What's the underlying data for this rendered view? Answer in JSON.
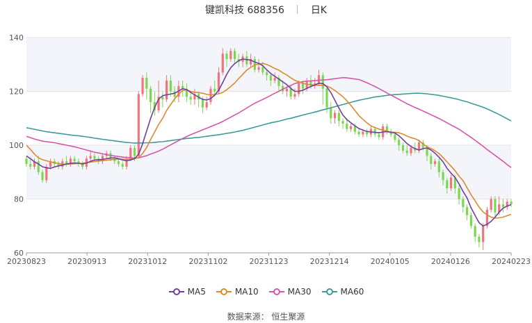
{
  "header": {
    "name": "键凯科技",
    "code": "688356",
    "period": "日K"
  },
  "source": "数据来源： 恒生聚源",
  "colors": {
    "up": "#f2737c",
    "down": "#79d84e",
    "ma5": "#6f3fa0",
    "ma10": "#e0882d",
    "ma30": "#d556a8",
    "ma60": "#3c9a9a",
    "band": "#f4f5fb",
    "grid": "#e3e3e3",
    "axis": "#555555"
  },
  "chart_data": {
    "type": "candlestick",
    "title": "键凯科技 688356 日K",
    "yticks": [
      60,
      80,
      100,
      120,
      140
    ],
    "ylim": [
      60,
      140
    ],
    "xticks": [
      "20230823",
      "20230913",
      "20231012",
      "20231102",
      "20231123",
      "20231214",
      "20240105",
      "20240126",
      "20240223"
    ],
    "legend": [
      {
        "key": "ma5",
        "label": "MA5"
      },
      {
        "key": "ma10",
        "label": "MA10"
      },
      {
        "key": "ma30",
        "label": "MA30"
      },
      {
        "key": "ma60",
        "label": "MA60"
      }
    ],
    "candles": [
      [
        95.0,
        93.0,
        96.0,
        92.0
      ],
      [
        93.0,
        92.0,
        95.0,
        91.0
      ],
      [
        92.0,
        94.0,
        95.0,
        91.0
      ],
      [
        94.0,
        90.0,
        96.0,
        89.0
      ],
      [
        90.0,
        87.0,
        91.0,
        86.0
      ],
      [
        87.0,
        92.0,
        93.0,
        86.0
      ],
      [
        92.0,
        94.0,
        95.0,
        91.0
      ],
      [
        94.0,
        93.0,
        95.0,
        92.0
      ],
      [
        93.0,
        92.0,
        94.0,
        91.0
      ],
      [
        92.0,
        94.0,
        95.0,
        91.0
      ],
      [
        94.0,
        93.0,
        96.0,
        92.0
      ],
      [
        93.0,
        95.0,
        96.0,
        92.0
      ],
      [
        95.0,
        94.0,
        96.0,
        93.0
      ],
      [
        94.0,
        93.0,
        95.0,
        92.0
      ],
      [
        93.0,
        92.0,
        94.0,
        91.0
      ],
      [
        92.0,
        95.0,
        96.0,
        91.0
      ],
      [
        95.0,
        96.0,
        98.0,
        94.0
      ],
      [
        96.0,
        95.0,
        97.0,
        94.0
      ],
      [
        95.0,
        94.0,
        96.0,
        93.0
      ],
      [
        94.0,
        96.0,
        97.0,
        93.0
      ],
      [
        96.0,
        97.0,
        98.0,
        95.0
      ],
      [
        97.0,
        95.0,
        98.0,
        94.0
      ],
      [
        95.0,
        94.0,
        96.0,
        93.0
      ],
      [
        94.0,
        93.0,
        95.0,
        92.0
      ],
      [
        93.0,
        92.0,
        94.0,
        91.0
      ],
      [
        92.0,
        95.0,
        96.0,
        91.0
      ],
      [
        95.0,
        99.0,
        100.0,
        94.0
      ],
      [
        99.0,
        96.0,
        100.0,
        94.0
      ],
      [
        96.0,
        119.0,
        120.0,
        95.0
      ],
      [
        119.0,
        125.0,
        126.0,
        118.0
      ],
      [
        125.0,
        121.0,
        127.0,
        117.0
      ],
      [
        121.0,
        116.0,
        122.0,
        112.0
      ],
      [
        116.0,
        113.0,
        120.0,
        111.0
      ],
      [
        113.0,
        118.0,
        124.0,
        112.0
      ],
      [
        118.0,
        117.0,
        120.0,
        114.0
      ],
      [
        117.0,
        124.0,
        126.0,
        116.0
      ],
      [
        124.0,
        120.0,
        126.0,
        118.0
      ],
      [
        120.0,
        118.0,
        122.0,
        116.0
      ],
      [
        118.0,
        122.0,
        124.0,
        116.0
      ],
      [
        122.0,
        121.0,
        124.0,
        118.0
      ],
      [
        121.0,
        118.0,
        123.0,
        116.0
      ],
      [
        118.0,
        117.0,
        120.0,
        115.0
      ],
      [
        117.0,
        119.0,
        121.0,
        115.0
      ],
      [
        119.0,
        117.0,
        120.0,
        114.0
      ],
      [
        117.0,
        114.0,
        118.0,
        112.0
      ],
      [
        114.0,
        116.0,
        118.0,
        113.0
      ],
      [
        116.0,
        121.0,
        122.0,
        115.0
      ],
      [
        121.0,
        120.0,
        124.0,
        118.0
      ],
      [
        120.0,
        127.0,
        129.0,
        119.0
      ],
      [
        127.0,
        134.0,
        136.0,
        126.0
      ],
      [
        134.0,
        132.0,
        135.0,
        129.0
      ],
      [
        132.0,
        135.0,
        136.0,
        131.0
      ],
      [
        135.0,
        132.0,
        136.0,
        130.0
      ],
      [
        132.0,
        131.0,
        134.0,
        129.0
      ],
      [
        131.0,
        133.0,
        134.0,
        129.0
      ],
      [
        133.0,
        130.0,
        135.0,
        129.0
      ],
      [
        130.0,
        132.0,
        134.0,
        129.0
      ],
      [
        132.0,
        128.0,
        133.0,
        127.0
      ],
      [
        128.0,
        129.0,
        132.0,
        127.0
      ],
      [
        129.0,
        127.0,
        131.0,
        126.0
      ],
      [
        127.0,
        126.0,
        128.0,
        124.0
      ],
      [
        126.0,
        124.0,
        127.0,
        122.0
      ],
      [
        124.0,
        125.0,
        127.0,
        123.0
      ],
      [
        125.0,
        122.0,
        126.0,
        120.0
      ],
      [
        122.0,
        120.0,
        124.0,
        119.0
      ],
      [
        120.0,
        121.0,
        122.0,
        118.0
      ],
      [
        121.0,
        118.0,
        122.0,
        117.0
      ],
      [
        118.0,
        119.0,
        121.0,
        117.0
      ],
      [
        119.0,
        123.0,
        124.0,
        118.0
      ],
      [
        123.0,
        121.0,
        124.0,
        119.0
      ],
      [
        121.0,
        124.0,
        125.0,
        120.0
      ],
      [
        124.0,
        122.0,
        126.0,
        121.0
      ],
      [
        122.0,
        123.0,
        125.0,
        121.0
      ],
      [
        123.0,
        126.0,
        128.0,
        122.0
      ],
      [
        126.0,
        121.0,
        127.0,
        115.0
      ],
      [
        121.0,
        114.0,
        122.0,
        112.0
      ],
      [
        114.0,
        110.0,
        116.0,
        108.0
      ],
      [
        110.0,
        112.0,
        113.0,
        108.0
      ],
      [
        112.0,
        109.0,
        113.0,
        107.0
      ],
      [
        109.0,
        108.0,
        110.0,
        106.0
      ],
      [
        108.0,
        106.0,
        110.0,
        105.0
      ],
      [
        106.0,
        107.0,
        108.0,
        105.0
      ],
      [
        107.0,
        105.0,
        108.0,
        104.0
      ],
      [
        105.0,
        104.0,
        106.0,
        103.0
      ],
      [
        104.0,
        105.0,
        106.0,
        103.0
      ],
      [
        105.0,
        104.0,
        106.0,
        103.0
      ],
      [
        104.0,
        106.0,
        107.0,
        103.0
      ],
      [
        106.0,
        104.0,
        107.0,
        103.0
      ],
      [
        104.0,
        103.0,
        105.0,
        102.0
      ],
      [
        103.0,
        107.0,
        108.0,
        102.0
      ],
      [
        107.0,
        105.0,
        108.0,
        104.0
      ],
      [
        105.0,
        104.0,
        106.0,
        103.0
      ],
      [
        104.0,
        102.0,
        105.0,
        101.0
      ],
      [
        102.0,
        100.0,
        103.0,
        98.0
      ],
      [
        100.0,
        98.0,
        101.0,
        97.0
      ],
      [
        98.0,
        97.0,
        100.0,
        96.0
      ],
      [
        97.0,
        99.0,
        100.0,
        96.0
      ],
      [
        99.0,
        98.0,
        101.0,
        97.0
      ],
      [
        98.0,
        101.0,
        102.0,
        97.0
      ],
      [
        101.0,
        99.0,
        102.0,
        98.0
      ],
      [
        99.0,
        96.0,
        100.0,
        94.0
      ],
      [
        96.0,
        93.0,
        97.0,
        91.0
      ],
      [
        93.0,
        94.0,
        95.0,
        92.0
      ],
      [
        94.0,
        90.0,
        95.0,
        88.0
      ],
      [
        90.0,
        87.0,
        91.0,
        85.0
      ],
      [
        87.0,
        84.0,
        88.0,
        82.0
      ],
      [
        84.0,
        88.0,
        89.0,
        83.0
      ],
      [
        88.0,
        84.0,
        89.0,
        82.0
      ],
      [
        84.0,
        80.0,
        85.0,
        78.0
      ],
      [
        80.0,
        77.0,
        81.0,
        75.0
      ],
      [
        77.0,
        74.0,
        78.0,
        72.0
      ],
      [
        74.0,
        70.0,
        75.0,
        69.0
      ],
      [
        70.0,
        66.0,
        71.0,
        64.0
      ],
      [
        66.0,
        64.0,
        67.0,
        62.0
      ],
      [
        64.0,
        70.0,
        71.0,
        61.0
      ],
      [
        70.0,
        76.0,
        77.0,
        69.0
      ],
      [
        76.0,
        80.0,
        81.0,
        75.0
      ],
      [
        80.0,
        75.0,
        81.0,
        73.0
      ],
      [
        75.0,
        78.0,
        81.0,
        74.0
      ],
      [
        78.0,
        77.0,
        80.0,
        75.0
      ],
      [
        77.0,
        79.0,
        80.0,
        76.0
      ],
      [
        79.0,
        78.0,
        80.0,
        77.0
      ]
    ],
    "ma5": [
      96.0,
      95.0,
      93.8,
      93.0,
      92.0,
      91.6,
      91.4,
      91.9,
      92.3,
      92.6,
      93.0,
      93.2,
      93.4,
      93.3,
      93.0,
      93.4,
      94.0,
      94.5,
      94.6,
      94.7,
      95.0,
      95.2,
      95.3,
      95.0,
      94.5,
      94.2,
      94.5,
      95.0,
      96.6,
      100.5,
      105.2,
      110.0,
      114.0,
      117.1,
      118.4,
      118.7,
      119.0,
      119.3,
      120.1,
      121.0,
      120.6,
      119.6,
      118.7,
      117.8,
      117.0,
      116.8,
      117.3,
      118.6,
      120.4,
      123.3,
      126.3,
      128.8,
      130.3,
      131.4,
      132.0,
      131.8,
      131.6,
      130.9,
      130.4,
      129.5,
      128.0,
      126.6,
      125.6,
      124.6,
      123.5,
      122.5,
      121.1,
      120.0,
      120.0,
      120.4,
      121.1,
      121.8,
      122.4,
      123.0,
      122.9,
      121.7,
      119.5,
      116.7,
      113.8,
      111.2,
      109.5,
      108.3,
      107.2,
      106.2,
      105.6,
      105.1,
      104.9,
      104.8,
      104.6,
      104.9,
      105.0,
      104.8,
      104.5,
      103.5,
      102.1,
      100.6,
      99.5,
      98.7,
      98.2,
      98.7,
      99.0,
      98.2,
      97.0,
      95.5,
      93.8,
      91.4,
      89.6,
      88.0,
      85.6,
      82.8,
      80.4,
      76.7,
      73.9,
      71.2,
      70.0,
      70.6,
      71.7,
      73.3,
      75.1,
      76.6,
      77.4,
      77.9
    ],
    "ma10": [
      100.0,
      98.4,
      96.7,
      95.3,
      94.6,
      94.2,
      93.8,
      93.5,
      93.2,
      92.9,
      92.9,
      93.0,
      93.1,
      93.2,
      93.3,
      93.5,
      93.7,
      93.9,
      94.1,
      94.3,
      94.4,
      94.6,
      94.7,
      94.8,
      94.8,
      94.7,
      94.8,
      95.0,
      95.4,
      96.9,
      99.1,
      102.1,
      104.9,
      107.7,
      110.0,
      112.9,
      115.1,
      117.2,
      119.0,
      120.3,
      120.6,
      120.0,
      119.6,
      119.5,
      119.3,
      118.9,
      118.7,
      118.8,
      119.1,
      119.6,
      120.6,
      121.8,
      123.1,
      124.8,
      126.3,
      127.9,
      128.9,
      129.8,
      130.1,
      130.4,
      130.0,
      129.3,
      128.5,
      127.9,
      126.9,
      126.1,
      125.0,
      124.1,
      123.5,
      123.0,
      122.6,
      122.5,
      122.3,
      122.2,
      122.3,
      122.0,
      121.3,
      120.3,
      119.2,
      118.0,
      116.5,
      114.8,
      112.9,
      111.0,
      109.6,
      108.3,
      107.2,
      106.5,
      106.0,
      105.6,
      105.2,
      104.9,
      104.8,
      104.6,
      104.1,
      103.4,
      102.8,
      102.4,
      101.7,
      100.5,
      99.4,
      98.8,
      97.9,
      96.9,
      95.4,
      93.8,
      92.2,
      90.5,
      88.5,
      86.8,
      84.2,
      81.6,
      79.3,
      77.0,
      75.2,
      74.1,
      73.3,
      72.9,
      73.0,
      73.3,
      73.8,
      74.3
    ],
    "ma30": [
      103.3,
      102.8,
      102.3,
      101.9,
      101.5,
      101.3,
      101.1,
      100.9,
      100.6,
      100.3,
      100.0,
      99.7,
      99.4,
      99.0,
      98.6,
      98.2,
      97.8,
      97.4,
      97.1,
      96.8,
      96.5,
      96.2,
      96.0,
      95.8,
      95.6,
      95.4,
      95.3,
      95.2,
      95.3,
      95.7,
      96.1,
      96.7,
      97.2,
      97.8,
      98.5,
      99.3,
      100.1,
      100.9,
      101.7,
      102.5,
      103.2,
      103.9,
      104.5,
      105.1,
      105.7,
      106.3,
      106.9,
      107.5,
      108.1,
      108.8,
      109.6,
      110.4,
      111.2,
      112.0,
      112.9,
      113.8,
      114.7,
      115.6,
      116.3,
      117.0,
      117.7,
      118.5,
      119.3,
      120.0,
      120.8,
      121.5,
      122.2,
      122.9,
      123.3,
      123.6,
      123.8,
      123.9,
      124.0,
      124.1,
      124.2,
      124.3,
      124.5,
      124.7,
      124.9,
      125.1,
      125.0,
      124.8,
      124.6,
      124.4,
      123.8,
      123.2,
      122.5,
      121.8,
      121.0,
      120.2,
      119.4,
      118.6,
      117.8,
      117.0,
      116.2,
      115.4,
      114.7,
      114.0,
      113.4,
      112.7,
      112.0,
      111.3,
      110.6,
      109.9,
      109.1,
      108.3,
      107.5,
      106.7,
      105.9,
      104.9,
      103.9,
      102.9,
      101.8,
      100.7,
      99.6,
      98.4,
      97.3,
      96.2,
      95.1,
      94.0,
      92.8,
      91.7
    ],
    "ma60": [
      106.5,
      106.2,
      105.9,
      105.6,
      105.3,
      105.0,
      104.8,
      104.6,
      104.4,
      104.2,
      104.0,
      103.8,
      103.6,
      103.5,
      103.3,
      103.1,
      102.9,
      102.6,
      102.4,
      102.2,
      102.0,
      101.8,
      101.6,
      101.4,
      101.2,
      101.0,
      100.9,
      100.8,
      100.8,
      100.8,
      100.9,
      100.9,
      101.0,
      101.2,
      101.3,
      101.5,
      101.7,
      101.9,
      102.1,
      102.3,
      102.5,
      102.6,
      102.8,
      102.9,
      103.1,
      103.3,
      103.5,
      103.7,
      103.9,
      104.1,
      104.4,
      104.6,
      104.9,
      105.2,
      105.5,
      105.9,
      106.3,
      106.7,
      107.1,
      107.5,
      107.9,
      108.3,
      108.6,
      108.9,
      109.3,
      109.7,
      110.0,
      110.4,
      110.8,
      111.2,
      111.6,
      111.9,
      112.3,
      112.7,
      113.1,
      113.5,
      113.9,
      114.3,
      114.7,
      115.1,
      115.5,
      115.9,
      116.3,
      116.7,
      117.0,
      117.3,
      117.6,
      117.9,
      118.1,
      118.3,
      118.5,
      118.7,
      118.8,
      118.9,
      119.0,
      119.1,
      119.2,
      119.3,
      119.3,
      119.2,
      119.1,
      118.9,
      118.7,
      118.5,
      118.2,
      117.9,
      117.6,
      117.3,
      116.9,
      116.5,
      116.1,
      115.6,
      115.1,
      114.6,
      114.1,
      113.5,
      112.8,
      112.1,
      111.4,
      110.6,
      109.8,
      109.0
    ]
  }
}
